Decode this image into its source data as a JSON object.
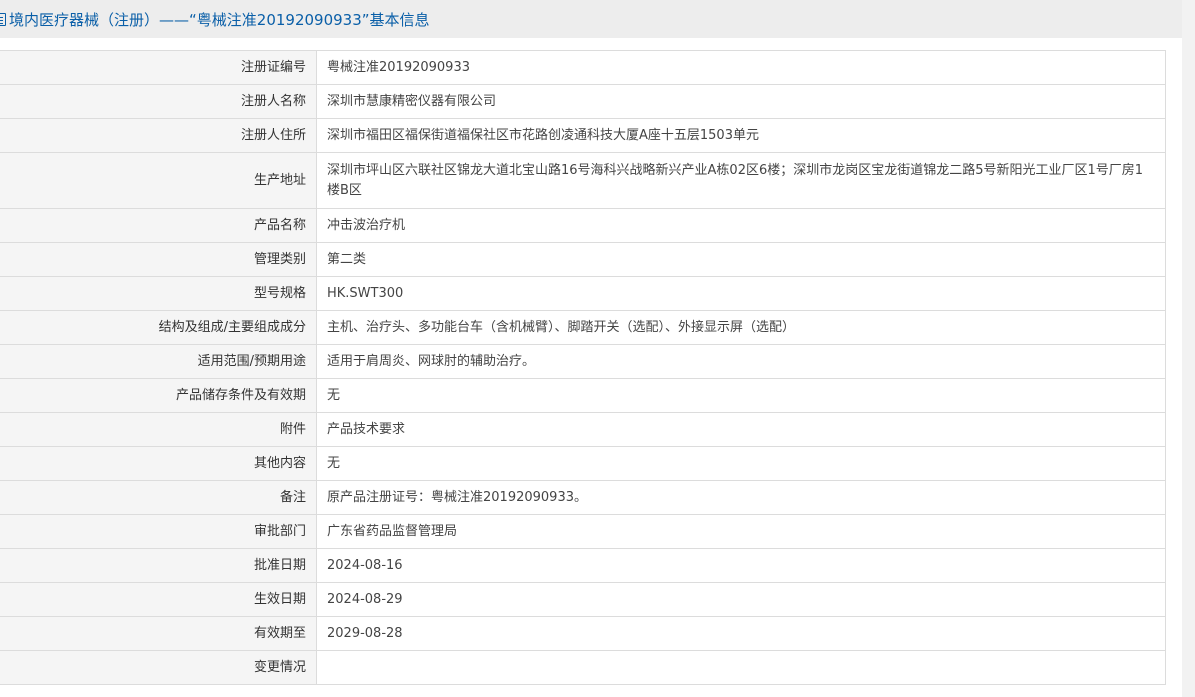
{
  "header": {
    "icon": "document-icon",
    "title": "境内医疗器械（注册）——“粤械注准20192090933”基本信息",
    "accent_color": "#0a5fa8"
  },
  "rows": [
    {
      "label": "注册证编号",
      "value": "粤械注准20192090933"
    },
    {
      "label": "注册人名称",
      "value": "深圳市慧康精密仪器有限公司"
    },
    {
      "label": "注册人住所",
      "value": "深圳市福田区福保街道福保社区市花路创凌通科技大厦A座十五层1503单元"
    },
    {
      "label": "生产地址",
      "value": "深圳市坪山区六联社区锦龙大道北宝山路16号海科兴战略新兴产业A栋02区6楼；深圳市龙岗区宝龙街道锦龙二路5号新阳光工业厂区1号厂房1楼B区"
    },
    {
      "label": "产品名称",
      "value": "冲击波治疗机"
    },
    {
      "label": "管理类别",
      "value": "第二类"
    },
    {
      "label": "型号规格",
      "value": "HK.SWT300"
    },
    {
      "label": "结构及组成/主要组成成分",
      "value": "主机、治疗头、多功能台车（含机械臂）、脚踏开关（选配）、外接显示屏（选配）"
    },
    {
      "label": "适用范围/预期用途",
      "value": "适用于肩周炎、网球肘的辅助治疗。"
    },
    {
      "label": "产品储存条件及有效期",
      "value": "无"
    },
    {
      "label": "附件",
      "value": "产品技术要求"
    },
    {
      "label": "其他内容",
      "value": "无"
    },
    {
      "label": "备注",
      "value": "原产品注册证号：粤械注准20192090933。"
    },
    {
      "label": "审批部门",
      "value": "广东省药品监督管理局"
    },
    {
      "label": "批准日期",
      "value": "2024-08-16"
    },
    {
      "label": "生效日期",
      "value": "2024-08-29"
    },
    {
      "label": "有效期至",
      "value": "2029-08-28"
    },
    {
      "label": "变更情况",
      "value": ""
    }
  ]
}
